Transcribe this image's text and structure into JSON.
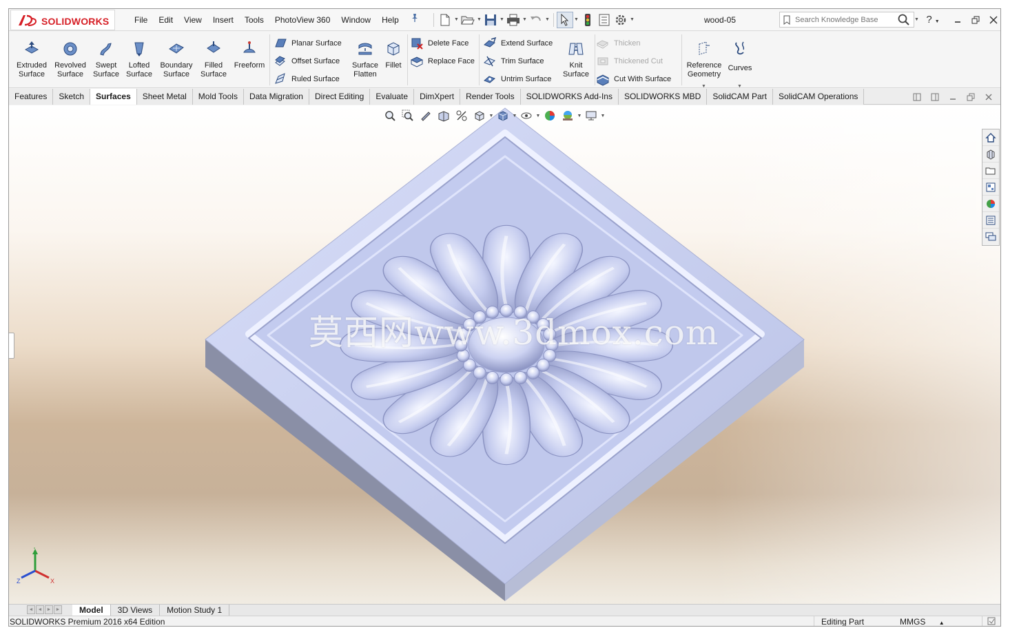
{
  "app": {
    "logo_text": "SOLIDWORKS",
    "document_title": "wood-05"
  },
  "menu": {
    "items": [
      "File",
      "Edit",
      "View",
      "Insert",
      "Tools",
      "PhotoView 360",
      "Window",
      "Help"
    ]
  },
  "search": {
    "placeholder": "Search Knowledge Base"
  },
  "help": {
    "label": "?"
  },
  "ribbon": {
    "big_buttons": [
      {
        "label": "Extruded\nSurface",
        "icon": "extruded-surface-icon"
      },
      {
        "label": "Revolved\nSurface",
        "icon": "revolved-surface-icon"
      },
      {
        "label": "Swept\nSurface",
        "icon": "swept-surface-icon"
      },
      {
        "label": "Lofted\nSurface",
        "icon": "lofted-surface-icon"
      },
      {
        "label": "Boundary\nSurface",
        "icon": "boundary-surface-icon"
      },
      {
        "label": "Filled\nSurface",
        "icon": "filled-surface-icon"
      },
      {
        "label": "Freeform",
        "icon": "freeform-icon"
      }
    ],
    "group2": [
      "Planar Surface",
      "Offset Surface",
      "Ruled Surface"
    ],
    "surface_flatten": "Surface\nFlatten",
    "fillet": "Fillet",
    "group3": [
      "Delete Face",
      "Replace Face"
    ],
    "group4": [
      "Extend Surface",
      "Trim Surface",
      "Untrim Surface"
    ],
    "knit_surface": "Knit\nSurface",
    "group5": [
      {
        "label": "Thicken",
        "disabled": true
      },
      {
        "label": "Thickened Cut",
        "disabled": true
      },
      {
        "label": "Cut With Surface",
        "disabled": false
      }
    ],
    "reference_geometry": "Reference\nGeometry",
    "curves": "Curves"
  },
  "tabs": {
    "items": [
      "Features",
      "Sketch",
      "Surfaces",
      "Sheet Metal",
      "Mold Tools",
      "Data Migration",
      "Direct Editing",
      "Evaluate",
      "DimXpert",
      "Render Tools",
      "SOLIDWORKS Add-Ins",
      "SOLIDWORKS MBD",
      "SolidCAM Part",
      "SolidCAM Operations"
    ],
    "active": "Surfaces"
  },
  "viewport": {
    "watermark": "莫西网www.3dmox.com",
    "triad_labels": {
      "x": "X",
      "y": "Y",
      "z": "Z"
    }
  },
  "bottom_tabs": {
    "items": [
      "Model",
      "3D Views",
      "Motion Study 1"
    ],
    "active": "Model"
  },
  "status": {
    "edition": "SOLIDWORKS Premium 2016 x64 Edition",
    "mode": "Editing Part",
    "units": "MMGS",
    "units_arrow": "▲"
  },
  "colors": {
    "brand_red": "#d61e25",
    "model_top": "#c9d1f2",
    "model_side_left": "#8a8fa6",
    "model_side_right": "#b7bdd6"
  }
}
